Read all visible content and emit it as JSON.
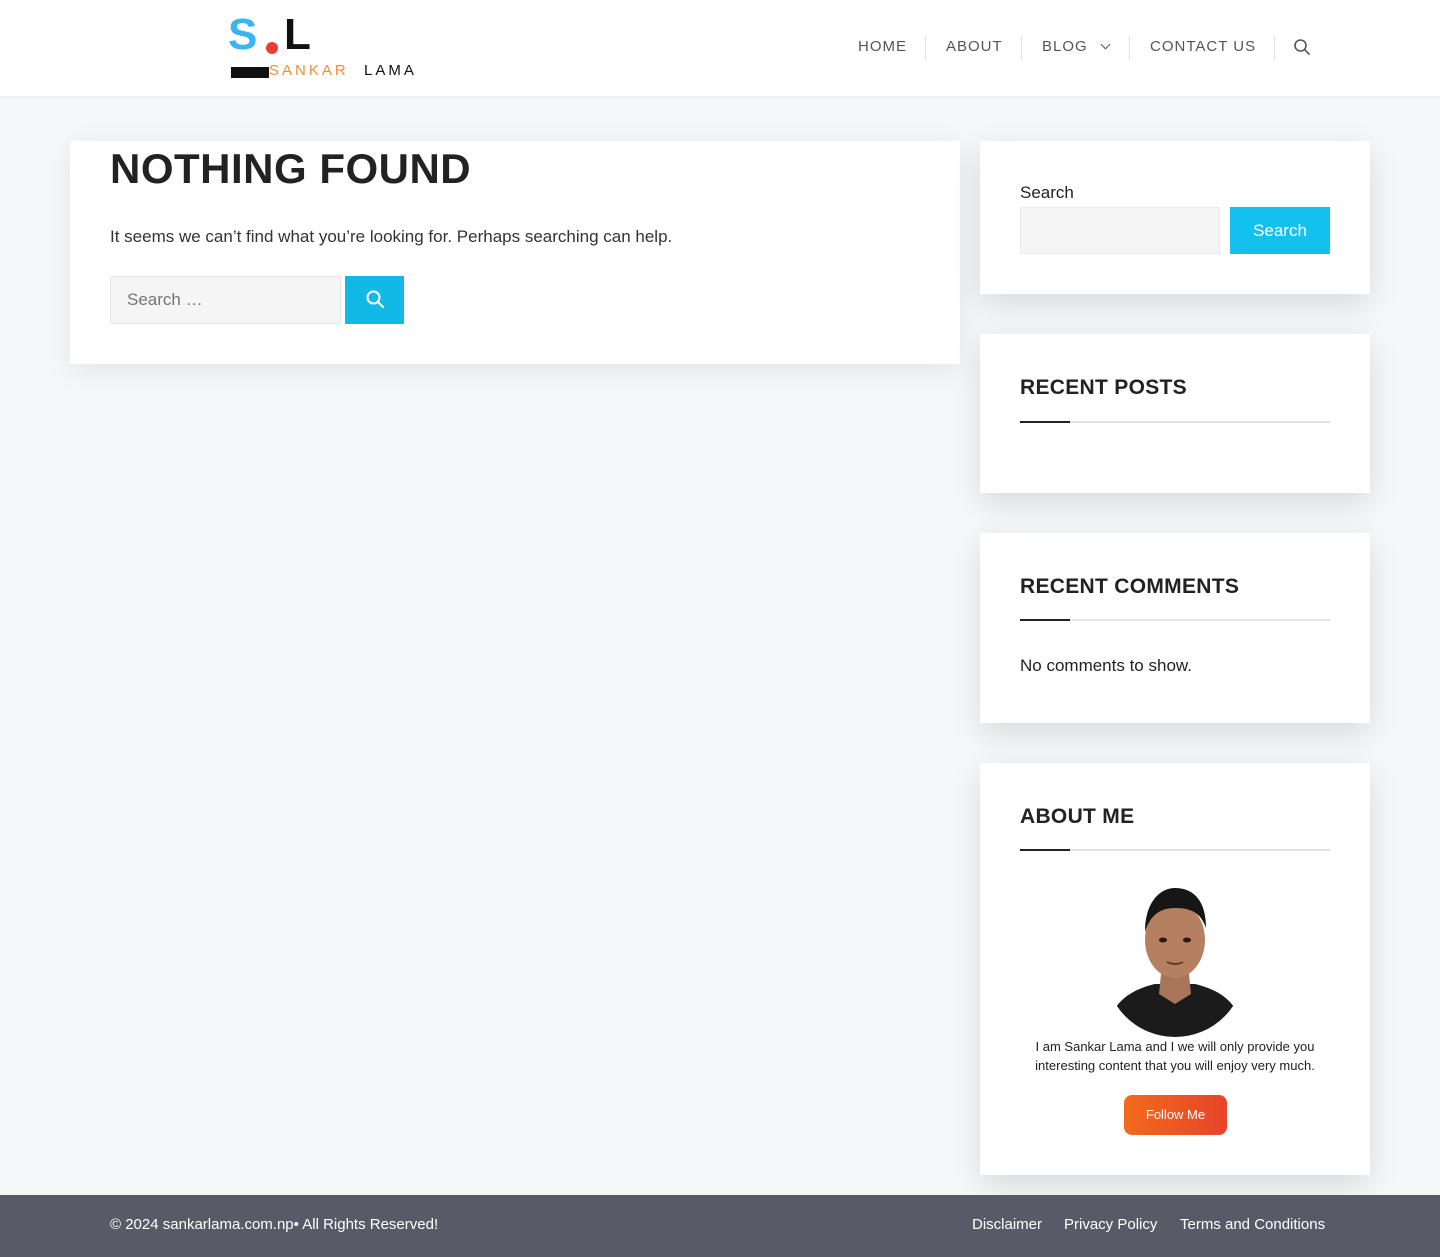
{
  "logo": {
    "initial_s": "S",
    "initial_l": "L",
    "first": "SANKAR",
    "last": "LAMA"
  },
  "nav": {
    "items": [
      {
        "label": "HOME"
      },
      {
        "label": "ABOUT"
      },
      {
        "label": "BLOG"
      },
      {
        "label": "CONTACT US"
      }
    ]
  },
  "main": {
    "title": "NOTHING FOUND",
    "message": "It seems we can’t find what you’re looking for. Perhaps searching can help.",
    "search_placeholder": "Search …"
  },
  "sidebar": {
    "search": {
      "label": "Search",
      "button": "Search"
    },
    "recent_posts": {
      "title": "RECENT POSTS"
    },
    "recent_comments": {
      "title": "RECENT COMMENTS",
      "empty": "No comments to show."
    },
    "about": {
      "title": "ABOUT ME",
      "text": "I am Sankar Lama and I we will only provide you interesting content that you will enjoy very much.",
      "button": "Follow Me"
    }
  },
  "footer": {
    "copyright": "© 2024 sankarlama.com.np• All Rights Reserved!",
    "links": [
      {
        "label": "Disclaimer"
      },
      {
        "label": "Privacy Policy"
      },
      {
        "label": "Terms and Conditions"
      }
    ]
  },
  "colors": {
    "accent": "#13c0ee",
    "orange": "#f26a1b",
    "footer": "#585a67"
  },
  "icons": [
    "search-icon",
    "chevron-down-icon"
  ]
}
